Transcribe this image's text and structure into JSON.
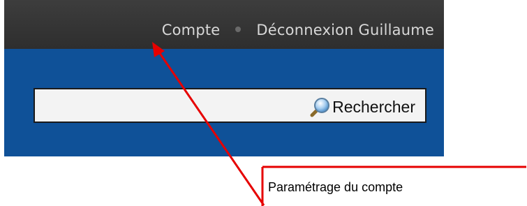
{
  "nav": {
    "account_label": "Compte",
    "logout_label": "Déconnexion Guillaume"
  },
  "search": {
    "button_label": "Rechercher",
    "icon": "magnifier-icon"
  },
  "annotation": {
    "label": "Paramétrage du compte",
    "arrow_color": "#e60000"
  },
  "colors": {
    "topbar": "#333333",
    "header_blue": "#0f5198",
    "search_bg": "#f3f3f3"
  }
}
